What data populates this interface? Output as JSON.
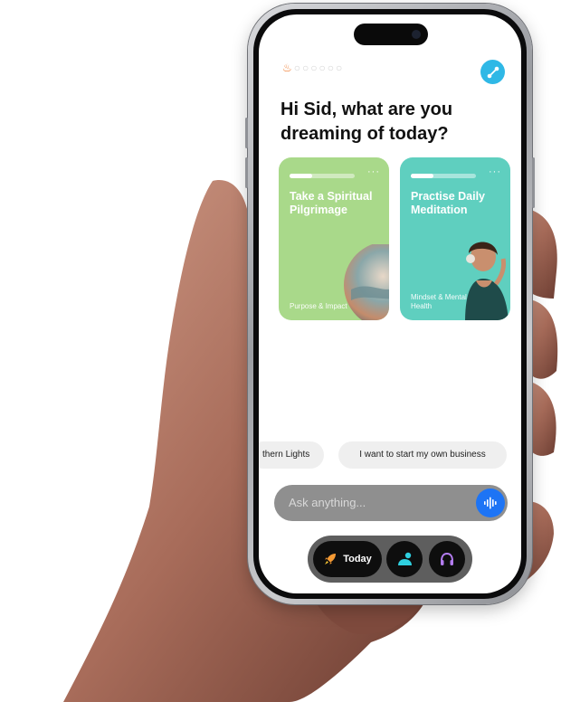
{
  "app": {
    "streak": {
      "active_days": 1,
      "total_days": 7
    },
    "greeting": "Hi Sid, what are you dreaming of today?",
    "cards": [
      {
        "title": "Take a Spiritual Pilgrimage",
        "category": "Purpose & Impact",
        "progress": 0.35,
        "color": "#a9d98a"
      },
      {
        "title": "Practise Daily Meditation",
        "category": "Mindset & Mental Health",
        "progress": 0.35,
        "color": "#5fcfbf"
      }
    ],
    "suggestions": [
      "thern Lights",
      "I want to start my own business"
    ],
    "ask_placeholder": "Ask anything...",
    "nav": {
      "today_label": "Today"
    },
    "colors": {
      "share": "#2fb8e6",
      "mic": "#1d74f5",
      "flame": "#f07a2b"
    },
    "icons": {
      "share": "share-icon",
      "mic": "voice-waveform-icon",
      "today": "rocket-icon",
      "community": "people-icon",
      "listen": "headphones-icon",
      "more": "ellipsis-icon"
    }
  }
}
